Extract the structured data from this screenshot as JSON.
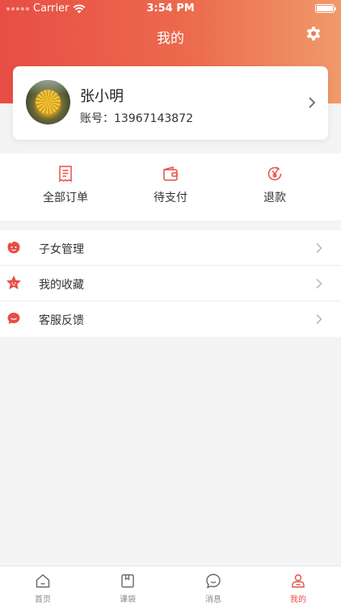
{
  "status_bar": {
    "carrier": "Carrier",
    "time": "3:54 PM"
  },
  "header": {
    "title": "我的"
  },
  "profile": {
    "name": "张小明",
    "account_label": "账号：",
    "account": "13967143872"
  },
  "quick_actions": [
    {
      "label": "全部订单",
      "icon": "receipt-icon"
    },
    {
      "label": "待支付",
      "icon": "wallet-icon"
    },
    {
      "label": "退款",
      "icon": "refund-yen-icon"
    }
  ],
  "menu": [
    {
      "label": "子女管理",
      "icon": "children-face-icon"
    },
    {
      "label": "我的收藏",
      "icon": "star-icon"
    },
    {
      "label": "客服反馈",
      "icon": "chat-bubble-icon"
    }
  ],
  "tabs": [
    {
      "label": "首页",
      "icon": "home-icon",
      "active": false
    },
    {
      "label": "课袋",
      "icon": "course-bag-icon",
      "active": false
    },
    {
      "label": "消息",
      "icon": "message-icon",
      "active": false
    },
    {
      "label": "我的",
      "icon": "profile-icon",
      "active": true
    }
  ],
  "colors": {
    "accent": "#e84e45",
    "gradient_end": "#f09a6a",
    "text": "#333333",
    "inactive_tab": "#888888"
  }
}
